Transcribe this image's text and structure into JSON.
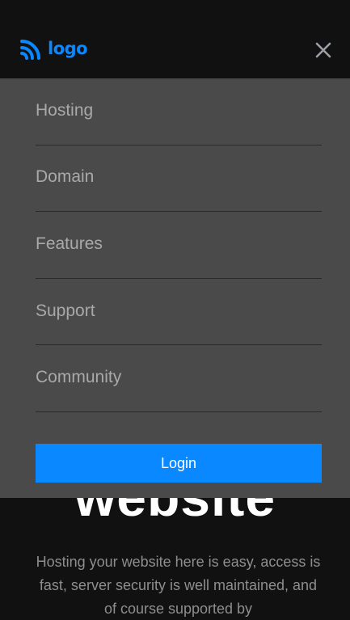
{
  "brand": {
    "logo_text": "logo",
    "logo_icon": "rss-feed-icon",
    "accent_color": "#0a88ff"
  },
  "header": {
    "close_icon": "close-icon"
  },
  "menu": {
    "items": [
      {
        "label": "Hosting"
      },
      {
        "label": "Domain"
      },
      {
        "label": "Features"
      },
      {
        "label": "Support"
      },
      {
        "label": "Community"
      }
    ],
    "login_label": "Login"
  },
  "hero": {
    "title": "website",
    "description": "Hosting your website here is easy, access is fast, server security is well maintained, and of course supported by"
  }
}
